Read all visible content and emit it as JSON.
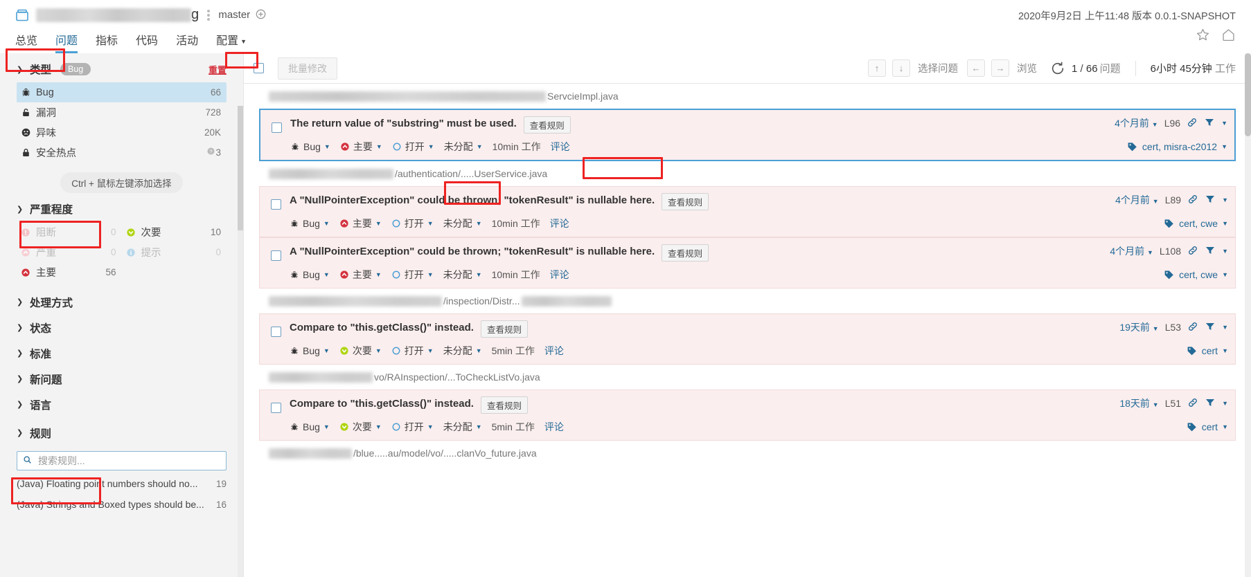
{
  "header": {
    "project_name_redacted_suffix": "g",
    "branch": "master",
    "analysis_date": "2020年9月2日 上午11:48  版本 0.0.1-SNAPSHOT",
    "star_icon": "star-icon",
    "home_icon": "home-icon",
    "box_icon": "project-box-icon"
  },
  "nav": {
    "items": [
      {
        "label": "总览",
        "active": false
      },
      {
        "label": "问题",
        "active": true
      },
      {
        "label": "指标",
        "active": false
      },
      {
        "label": "代码",
        "active": false
      },
      {
        "label": "活动",
        "active": false
      },
      {
        "label": "配置",
        "active": false,
        "has_caret": true
      }
    ]
  },
  "sidebar": {
    "type_facet": {
      "title": "类型",
      "chip": "Bug",
      "reset": "重置",
      "items": [
        {
          "label": "Bug",
          "count": "66",
          "icon": "bug-icon",
          "active": true
        },
        {
          "label": "漏洞",
          "count": "728",
          "icon": "vulnerability-icon",
          "active": false
        },
        {
          "label": "异味",
          "count": "20K",
          "icon": "code-smell-icon",
          "active": false
        },
        {
          "label": "安全热点",
          "count": "3",
          "icon": "security-hotspot-icon",
          "active": false,
          "help": true
        }
      ]
    },
    "hint": "Ctrl + 鼠标左键添加选择",
    "severity_facet": {
      "title": "严重程度",
      "items": [
        {
          "label": "阻断",
          "count": "0",
          "icon": "blocker-icon",
          "disabled": true
        },
        {
          "label": "次要",
          "count": "10",
          "icon": "minor-icon",
          "disabled": false
        },
        {
          "label": "严重",
          "count": "0",
          "icon": "critical-icon",
          "disabled": true
        },
        {
          "label": "提示",
          "count": "0",
          "icon": "info-icon",
          "disabled": true
        },
        {
          "label": "主要",
          "count": "56",
          "icon": "major-icon",
          "disabled": false
        }
      ]
    },
    "collapsed_facets": [
      {
        "label": "处理方式"
      },
      {
        "label": "状态"
      },
      {
        "label": "标准"
      },
      {
        "label": "新问题"
      },
      {
        "label": "语言"
      }
    ],
    "rules_facet": {
      "title": "规则",
      "search_placeholder": "搜索规则...",
      "search_value": "",
      "items": [
        {
          "label": "(Java) Floating point numbers should no...",
          "count": "19"
        },
        {
          "label": "(Java) Strings and Boxed types should be...",
          "count": "16"
        }
      ]
    }
  },
  "toolbar": {
    "bulk_change": "批量修改",
    "key_up": "↑",
    "key_down": "↓",
    "select_issue_label": "选择问题",
    "key_left": "←",
    "key_right": "→",
    "browse_label": "浏览",
    "reload_icon": "reload-icon",
    "current_index": "1",
    "total": "66",
    "issues_unit": "问题",
    "effort": "6小时 45分钟",
    "effort_unit": "工作"
  },
  "issues": [
    {
      "path_prefix_redacted": true,
      "path_text": "ServcieImpl.java",
      "message": "The return value of \"substring\" must be used.",
      "rule_button": "查看规则",
      "type": "Bug",
      "type_icon": "bug-icon",
      "severity": "主要",
      "severity_icon": "major-icon",
      "status": "打开",
      "status_icon": "open-status-icon",
      "assignee": "未分配",
      "effort": "10min",
      "effort_unit": "工作",
      "comment": "评论",
      "date": "4个月前",
      "line": "L96",
      "link_icon": "permalink-icon",
      "filter_icon": "filter-icon",
      "tags": "cert, misra-c2012",
      "tags_icon": "tags-icon",
      "selected": true,
      "annotated_rule_button": true,
      "annotated_status": true
    },
    {
      "path_prefix_redacted": true,
      "path_text": "/authentication/.....UserService.java",
      "message": "A \"NullPointerException\" could be thrown; \"tokenResult\" is nullable here.",
      "rule_button": "查看规则",
      "type": "Bug",
      "type_icon": "bug-icon",
      "severity": "主要",
      "severity_icon": "major-icon",
      "status": "打开",
      "status_icon": "open-status-icon",
      "assignee": "未分配",
      "effort": "10min",
      "effort_unit": "工作",
      "comment": "评论",
      "date": "4个月前",
      "line": "L89",
      "link_icon": "permalink-icon",
      "filter_icon": "filter-icon",
      "tags": "cert, cwe",
      "tags_icon": "tags-icon",
      "selected": false
    },
    {
      "path_prefix_redacted": false,
      "path_text": "",
      "message": "A \"NullPointerException\" could be thrown; \"tokenResult\" is nullable here.",
      "rule_button": "查看规则",
      "type": "Bug",
      "type_icon": "bug-icon",
      "severity": "主要",
      "severity_icon": "major-icon",
      "status": "打开",
      "status_icon": "open-status-icon",
      "assignee": "未分配",
      "effort": "10min",
      "effort_unit": "工作",
      "comment": "评论",
      "date": "4个月前",
      "line": "L108",
      "link_icon": "permalink-icon",
      "filter_icon": "filter-icon",
      "tags": "cert, cwe",
      "tags_icon": "tags-icon",
      "selected": false
    },
    {
      "path_prefix_redacted": true,
      "path_text": "/inspection/Distr...",
      "message": "Compare to \"this.getClass()\" instead.",
      "rule_button": "查看规则",
      "type": "Bug",
      "type_icon": "bug-icon",
      "severity": "次要",
      "severity_icon": "minor-icon",
      "status": "打开",
      "status_icon": "open-status-icon",
      "assignee": "未分配",
      "effort": "5min",
      "effort_unit": "工作",
      "comment": "评论",
      "date": "19天前",
      "line": "L53",
      "link_icon": "permalink-icon",
      "filter_icon": "filter-icon",
      "tags": "cert",
      "tags_icon": "tags-icon",
      "selected": false
    },
    {
      "path_prefix_redacted": true,
      "path_text": "vo/RAInspection/...ToCheckListVo.java",
      "message": "Compare to \"this.getClass()\" instead.",
      "rule_button": "查看规则",
      "type": "Bug",
      "type_icon": "bug-icon",
      "severity": "次要",
      "severity_icon": "minor-icon",
      "status": "打开",
      "status_icon": "open-status-icon",
      "assignee": "未分配",
      "effort": "5min",
      "effort_unit": "工作",
      "comment": "评论",
      "date": "18天前",
      "line": "L51",
      "link_icon": "permalink-icon",
      "filter_icon": "filter-icon",
      "tags": "cert",
      "tags_icon": "tags-icon",
      "selected": false
    }
  ],
  "last_path": {
    "path_text": "/blue.....au/model/vo/.....clanVo_future.java"
  },
  "colors": {
    "accent_blue": "#4b9fd5",
    "link_blue": "#236a97",
    "issue_bg": "#fbeeee",
    "annotation_red": "#ee2222",
    "reset_red": "#d4333f",
    "major_red": "#d4333f",
    "minor_green": "#b0d513",
    "sidebar_bg": "#f3f3f3"
  }
}
